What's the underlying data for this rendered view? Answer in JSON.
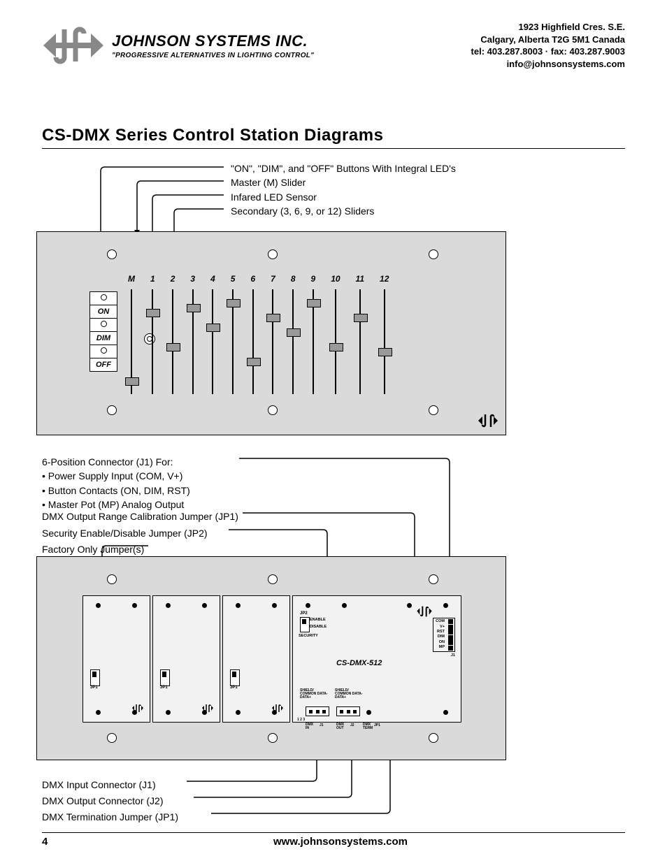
{
  "header": {
    "company_name": "JOHNSON SYSTEMS INC.",
    "tagline": "\"PROGRESSIVE ALTERNATIVES IN LIGHTING CONTROL\"",
    "address_line1": "1923 Highfield Cres. S.E.",
    "address_line2": "Calgary, Alberta  T2G 5M1 Canada",
    "address_line3": "tel: 403.287.8003 · fax: 403.287.9003",
    "address_line4": "info@johnsonsystems.com"
  },
  "title": "CS-DMX Series Control Station Diagrams",
  "callouts_top": [
    "\"ON\", \"DIM\", and \"OFF\" Buttons With Integral LED's",
    "Master (M) Slider",
    "Infared LED Sensor",
    "Secondary (3, 6, 9, or 12) Sliders"
  ],
  "front_panel": {
    "buttons": [
      "ON",
      "DIM",
      "OFF"
    ],
    "slider_labels": [
      "M",
      "1",
      "2",
      "3",
      "4",
      "5",
      "6",
      "7",
      "8",
      "9",
      "10",
      "11",
      "12"
    ],
    "slider_positions": [
      90,
      20,
      55,
      15,
      35,
      10,
      70,
      25,
      40,
      10,
      55,
      25,
      60
    ]
  },
  "mid_block_1": {
    "line1": "6-Position Connector (J1) For:",
    "line2": "• Power Supply Input (COM, V+)",
    "line3": "• Button Contacts (ON, DIM, RST)",
    "line4": "• Master Pot (MP) Analog Output"
  },
  "mid_block_2": "DMX Output Range Calibration Jumper (JP1)",
  "mid_block_3": "Security Enable/Disable Jumper (JP2)",
  "mid_block_4": "Factory Only Jumper(s)",
  "back_panel": {
    "jp_label": "JP1",
    "jp2_label": "JP2",
    "sec_enable": "ENABLE",
    "sec_disable": "DISABLE",
    "sec_title": "SECURITY",
    "model": "CS-DMX-512",
    "j1_pins": [
      "COM",
      "V+",
      "RST",
      "DIM",
      "ON",
      "MP"
    ],
    "j1_name": "J1",
    "dmx_in_hdr": "SHIELD/\nCOMMON DATA-  DATA+",
    "dmx_in_label": "DMX\nIN",
    "dmx_out_label": "DMX\nOUT",
    "dmx_in_pins": "1  2  3",
    "dmx_j1": "J1",
    "dmx_j2": "J2",
    "dmx_term": "DMX\nTERM",
    "dmx_jp1": "JP1"
  },
  "callouts_bottom": [
    "DMX Input Connector (J1)",
    "DMX Output Connector (J2)",
    "DMX Termination Jumper (JP1)"
  ],
  "footer": {
    "page": "4",
    "url": "www.johnsonsystems.com"
  }
}
